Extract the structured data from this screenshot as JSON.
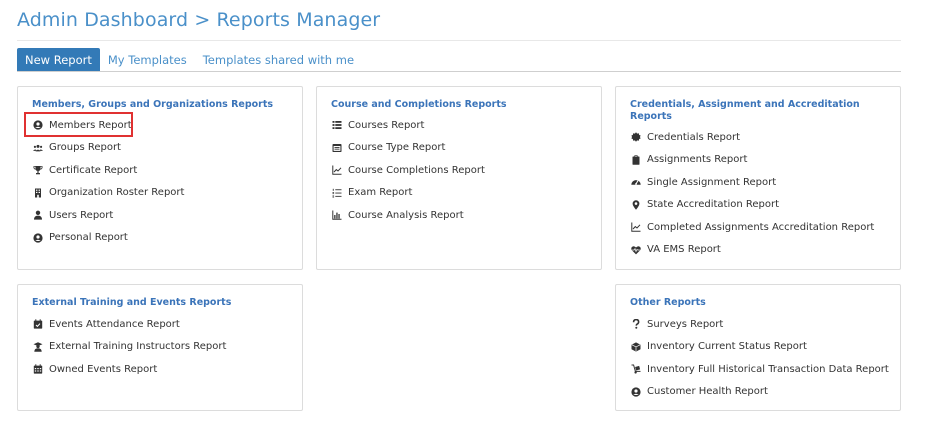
{
  "header": {
    "title": "Admin Dashboard > Reports Manager"
  },
  "tabs": [
    {
      "label": "New Report",
      "active": true
    },
    {
      "label": "My Templates",
      "active": false
    },
    {
      "label": "Templates shared with me",
      "active": false
    }
  ],
  "cards": {
    "members": {
      "title": "Members, Groups and Organizations Reports",
      "items": [
        {
          "label": "Members Report",
          "icon": "user-circle-icon"
        },
        {
          "label": "Groups Report",
          "icon": "users-icon"
        },
        {
          "label": "Certificate Report",
          "icon": "trophy-icon"
        },
        {
          "label": "Organization Roster Report",
          "icon": "building-icon"
        },
        {
          "label": "Users Report",
          "icon": "user-icon"
        },
        {
          "label": "Personal Report",
          "icon": "user-circle-icon"
        }
      ]
    },
    "courses": {
      "title": "Course and Completions Reports",
      "items": [
        {
          "label": "Courses Report",
          "icon": "list-icon"
        },
        {
          "label": "Course Type Report",
          "icon": "window-icon"
        },
        {
          "label": "Course Completions Report",
          "icon": "line-chart-icon"
        },
        {
          "label": "Exam Report",
          "icon": "ordered-list-icon"
        },
        {
          "label": "Course Analysis Report",
          "icon": "area-chart-icon"
        }
      ]
    },
    "credentials": {
      "title": "Credentials, Assignment and Accreditation Reports",
      "items": [
        {
          "label": "Credentials Report",
          "icon": "certificate-icon"
        },
        {
          "label": "Assignments Report",
          "icon": "clipboard-icon"
        },
        {
          "label": "Single Assignment Report",
          "icon": "tachometer-icon"
        },
        {
          "label": "State Accreditation Report",
          "icon": "map-marker-icon"
        },
        {
          "label": "Completed Assignments Accreditation Report",
          "icon": "line-chart-icon"
        },
        {
          "label": "VA EMS Report",
          "icon": "heartbeat-icon"
        }
      ]
    },
    "external": {
      "title": "External Training and Events Reports",
      "items": [
        {
          "label": "Events Attendance Report",
          "icon": "calendar-check-icon"
        },
        {
          "label": "External Training Instructors Report",
          "icon": "instructor-icon"
        },
        {
          "label": "Owned Events Report",
          "icon": "calendar-icon"
        }
      ]
    },
    "other": {
      "title": "Other Reports",
      "items": [
        {
          "label": "Surveys Report",
          "icon": "question-icon"
        },
        {
          "label": "Inventory Current Status Report",
          "icon": "box-icon"
        },
        {
          "label": "Inventory Full Historical Transaction Data Report",
          "icon": "dolly-icon"
        },
        {
          "label": "Customer Health Report",
          "icon": "user-circle-icon"
        }
      ]
    }
  },
  "colors": {
    "accent": "#337ab7",
    "title": "#4a90c9",
    "card_title": "#3b74b9",
    "highlight": "#e03131"
  }
}
